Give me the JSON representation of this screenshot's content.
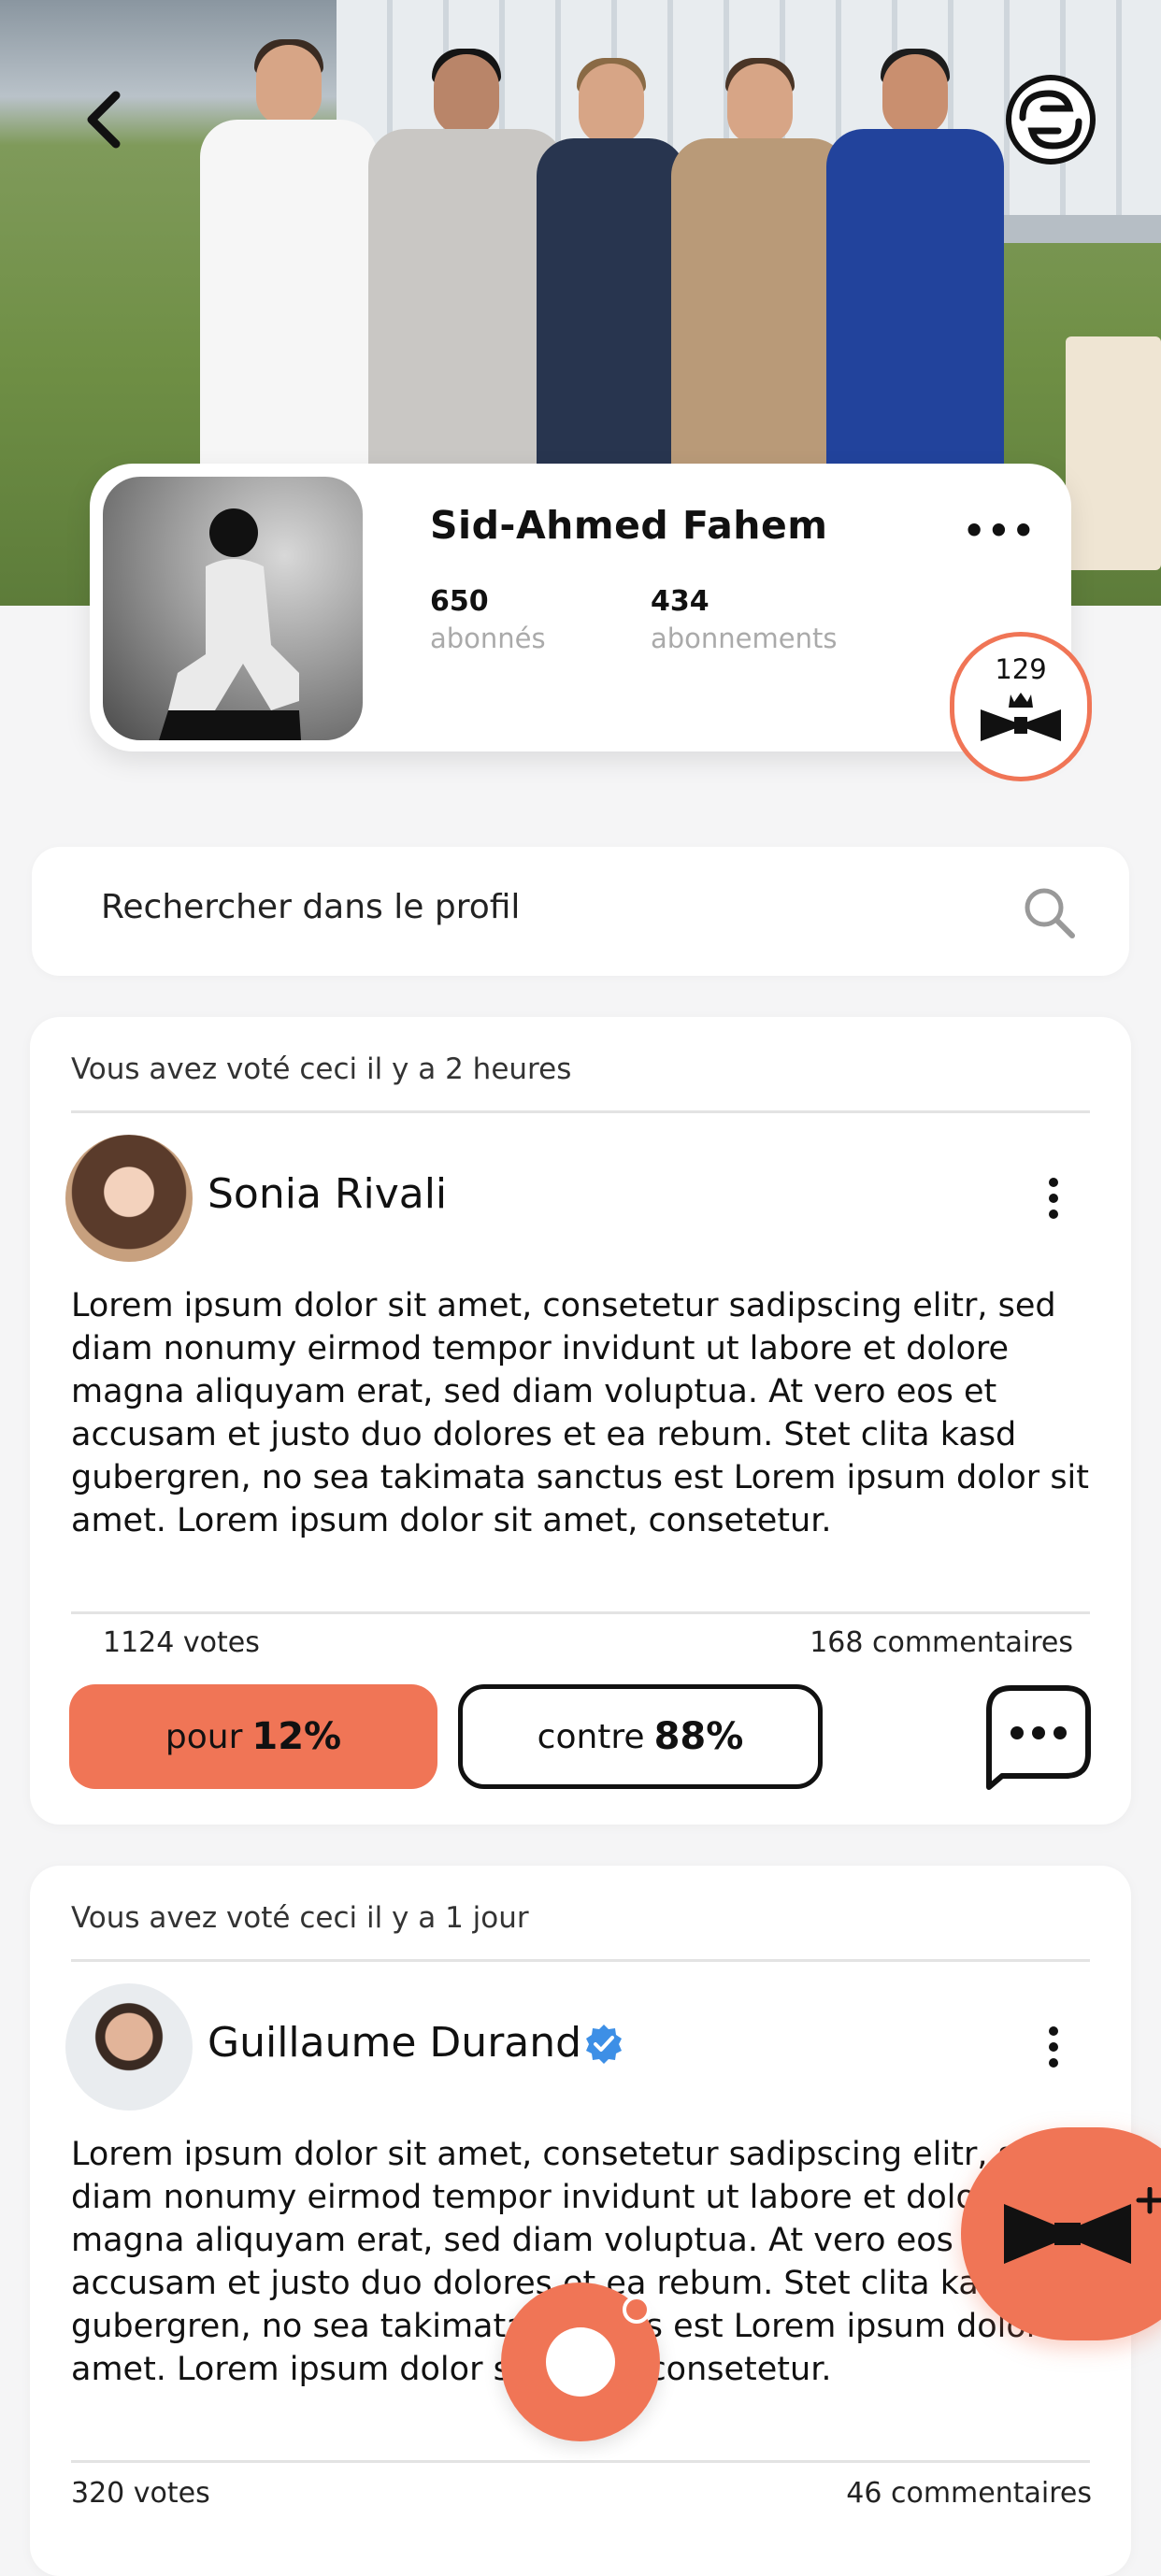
{
  "header": {
    "back_icon": "chevron-left-icon",
    "logo_icon": "brand-logo-icon"
  },
  "profile": {
    "name": "Sid-Ahmed Fahem",
    "more_label": "•••",
    "followers_count": "650",
    "followers_label": "abonnés",
    "following_count": "434",
    "following_label": "abonnements",
    "badge_count": "129",
    "badge_icon": "crown-ribbon-icon"
  },
  "search": {
    "placeholder": "Rechercher dans le profil",
    "icon": "search-icon"
  },
  "posts": [
    {
      "meta": "Vous avez voté ceci il y a 2 heures",
      "author": "Sonia Rivali",
      "verified": false,
      "text": "Lorem ipsum dolor sit amet, consetetur sadipscing elitr, sed diam nonumy eirmod tempor invidunt ut labore et dolore magna aliquyam erat, sed diam voluptua. At vero eos et accusam et justo duo dolores et ea rebum. Stet clita kasd gubergren, no sea takimata sanctus est Lorem ipsum dolor sit amet. Lorem ipsum dolor sit amet, consetetur.",
      "votes": "1124 votes",
      "comments": "168 commentaires",
      "pour_label": "pour",
      "pour_pct": "12%",
      "contre_label": "contre",
      "contre_pct": "88%"
    },
    {
      "meta": "Vous avez voté ceci il y a 1 jour",
      "author": "Guillaume Durand",
      "verified": true,
      "text": "Lorem ipsum dolor sit amet, consetetur sadipscing elitr, sed diam nonumy eirmod tempor invidunt ut labore et dolore magna aliquyam erat, sed diam voluptua. At vero eos et accusam et justo duo dolores et ea rebum. Stet clita kasd gubergren, no sea takimata sanctus est Lorem ipsum dolor sit amet. Lorem ipsum dolor sit amet, consetetur.",
      "votes": "320 votes",
      "comments": "46 commentaires"
    }
  ],
  "colors": {
    "accent": "#f07556",
    "verified": "#3d8fe6",
    "background": "#f5f5f6"
  }
}
